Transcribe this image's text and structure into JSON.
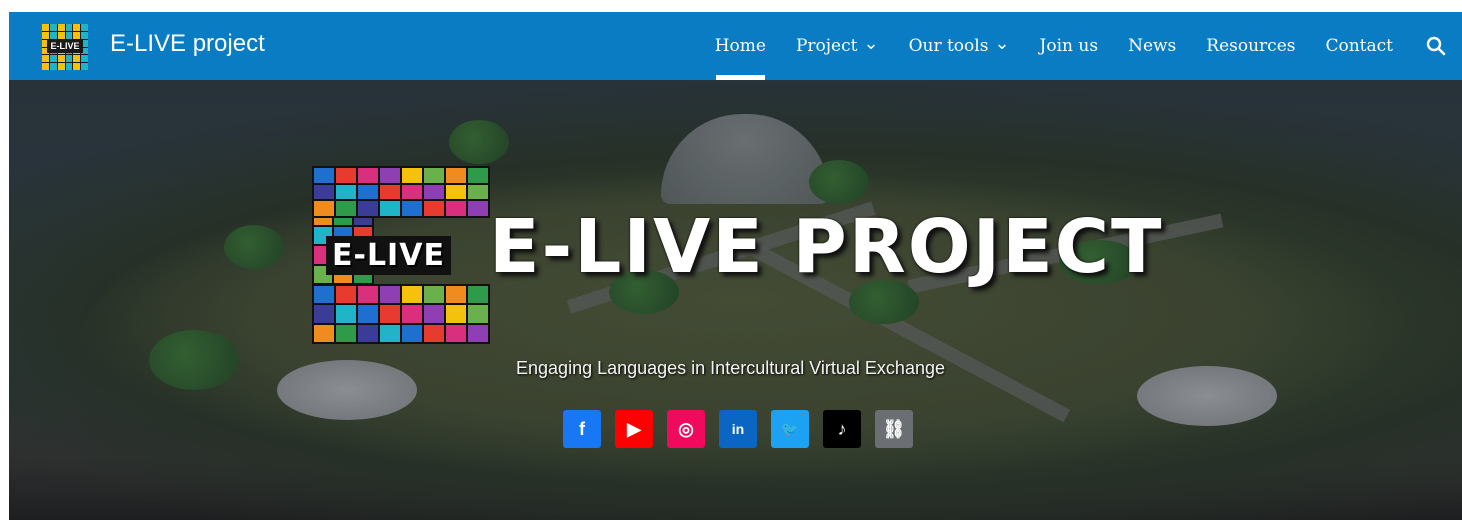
{
  "header": {
    "brand": "E-LIVE project",
    "logo_badge": "E-LIVE",
    "nav": [
      {
        "label": "Home",
        "active": true,
        "dropdown": false
      },
      {
        "label": "Project",
        "active": false,
        "dropdown": true
      },
      {
        "label": "Our tools",
        "active": false,
        "dropdown": true
      },
      {
        "label": "Join us",
        "active": false,
        "dropdown": false
      },
      {
        "label": "News",
        "active": false,
        "dropdown": false
      },
      {
        "label": "Resources",
        "active": false,
        "dropdown": false
      },
      {
        "label": "Contact",
        "active": false,
        "dropdown": false
      }
    ],
    "search_icon": "search-icon",
    "bar_color": "#0a7cc3"
  },
  "hero": {
    "logo_label": "E-LIVE",
    "title": "E-LIVE PROJECT",
    "tagline": "Engaging Languages in Intercultural Virtual Exchange",
    "socials": [
      {
        "name": "facebook-icon",
        "glyph": "f",
        "color": "#1877f2"
      },
      {
        "name": "youtube-icon",
        "glyph": "▶",
        "color": "#ff0000"
      },
      {
        "name": "instagram-icon",
        "glyph": "◎",
        "color": "#f0095c"
      },
      {
        "name": "linkedin-icon",
        "glyph": "in",
        "color": "#0a66c2"
      },
      {
        "name": "twitter-icon",
        "glyph": "🐦",
        "color": "#1da1f2"
      },
      {
        "name": "tiktok-icon",
        "glyph": "♪",
        "color": "#000000"
      },
      {
        "name": "link-icon",
        "glyph": "⛓",
        "color": "#6b6f73"
      }
    ]
  }
}
